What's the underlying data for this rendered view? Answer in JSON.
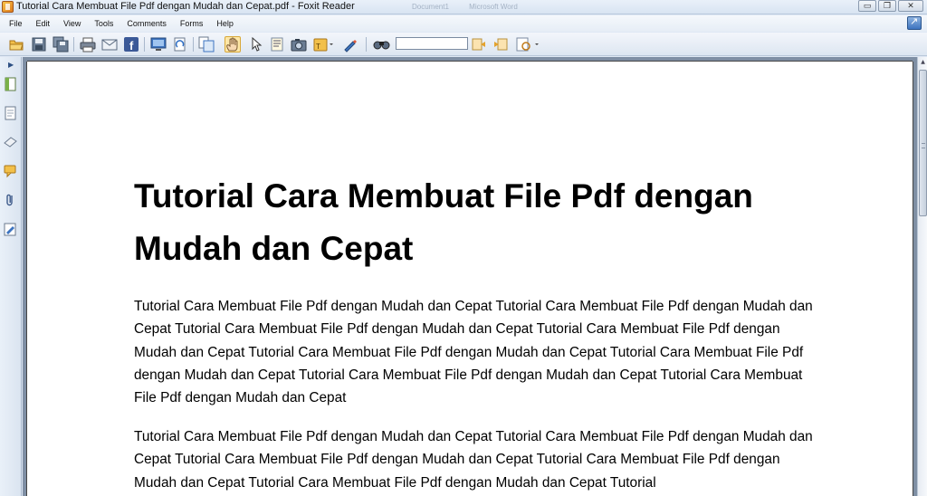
{
  "window": {
    "title": "Tutorial Cara Membuat File Pdf dengan Mudah dan Cepat.pdf - Foxit Reader",
    "background_titles": [
      "Document1",
      "Microsoft Word"
    ],
    "minimize_glyph": "▭",
    "restore_glyph": "❐",
    "close_glyph": "✕"
  },
  "menu": {
    "items": [
      "File",
      "Edit",
      "View",
      "Tools",
      "Comments",
      "Forms",
      "Help"
    ]
  },
  "toolbar": {
    "icons": [
      "open-folder-icon",
      "save-icon",
      "save-all-icon",
      "print-icon",
      "email-icon",
      "facebook-icon",
      "fullscreen-icon",
      "rotate-icon",
      "page-view-icon",
      "hand-icon",
      "select-icon",
      "text-select-icon",
      "snapshot-icon",
      "typewriter-icon",
      "comment-tool-icon",
      "find-icon",
      "find-prev-icon",
      "find-next-icon",
      "search-options-icon"
    ],
    "active_tool": "hand-icon",
    "find_value": ""
  },
  "side_panel": {
    "icons": [
      "bookmarks-icon",
      "pages-icon",
      "layers-icon",
      "comments-icon",
      "attachments-icon",
      "signatures-icon"
    ]
  },
  "document": {
    "title": "Tutorial Cara Membuat File Pdf dengan Mudah dan Cepat",
    "paragraphs": [
      "Tutorial Cara Membuat File Pdf dengan Mudah dan Cepat Tutorial Cara Membuat File Pdf dengan Mudah dan Cepat Tutorial Cara Membuat File Pdf dengan Mudah dan Cepat Tutorial Cara Membuat File Pdf dengan Mudah dan Cepat Tutorial Cara Membuat File Pdf dengan Mudah dan Cepat Tutorial Cara Membuat File Pdf dengan Mudah dan Cepat Tutorial Cara Membuat File Pdf dengan Mudah dan Cepat Tutorial Cara Membuat File Pdf dengan Mudah dan Cepat",
      "Tutorial Cara Membuat File Pdf dengan Mudah dan Cepat Tutorial Cara Membuat File Pdf dengan Mudah dan Cepat Tutorial Cara Membuat File Pdf dengan Mudah dan Cepat Tutorial Cara Membuat File Pdf dengan Mudah dan Cepat Tutorial Cara Membuat File Pdf dengan Mudah dan Cepat Tutorial"
    ]
  },
  "colors": {
    "chrome": "#dfe8f4",
    "page": "#ffffff",
    "canvas": "#7f8fa4",
    "active_tool": "#fde7a8"
  }
}
